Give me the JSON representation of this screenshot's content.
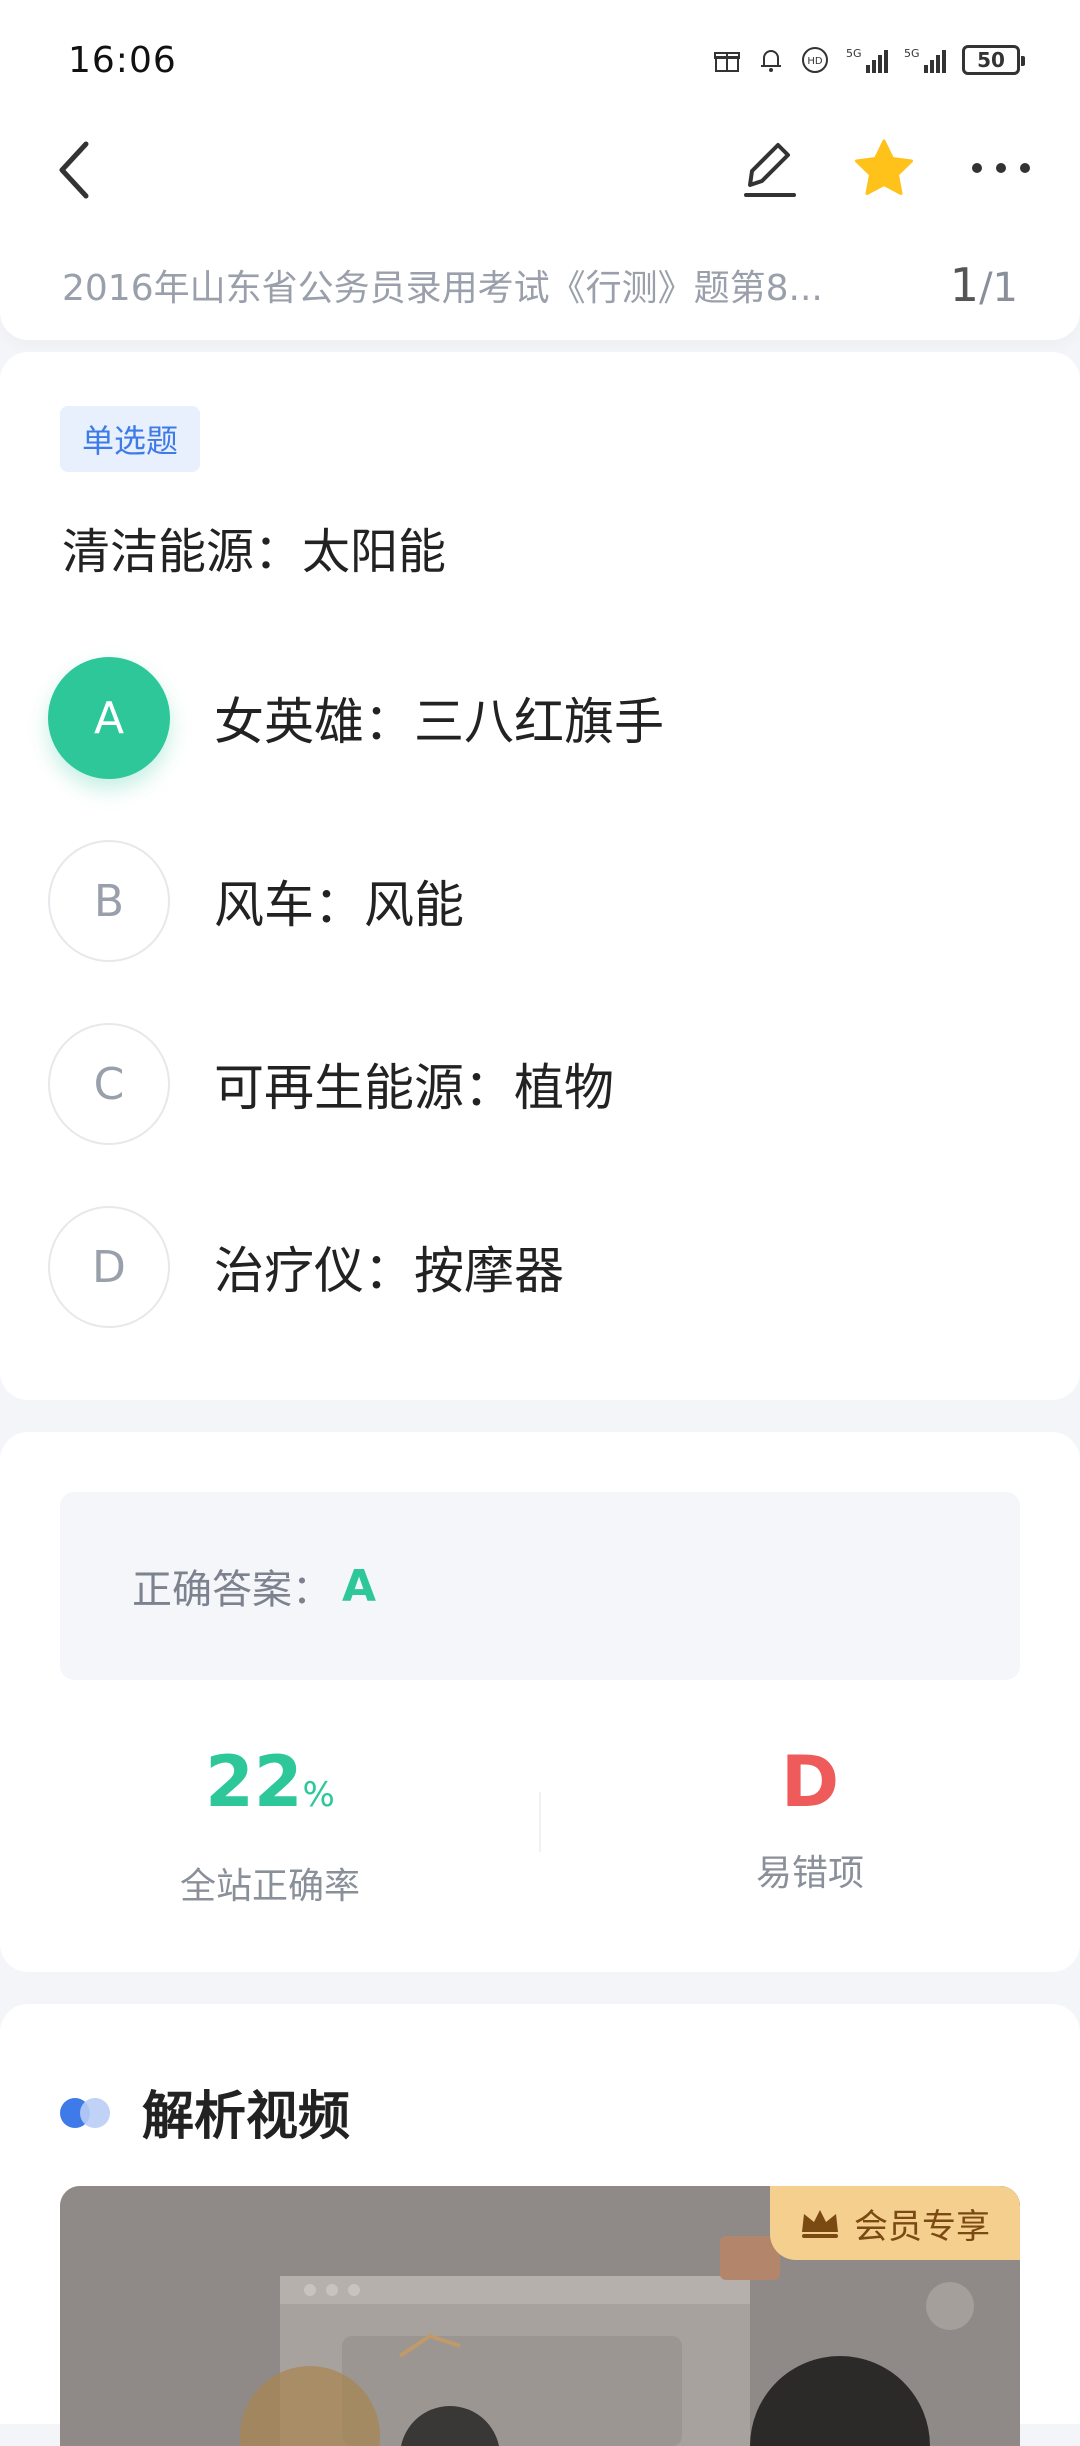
{
  "status_bar": {
    "time": "16:06",
    "icons": [
      "gift-icon",
      "bell-icon",
      "hd-icon",
      "5g-signal-icon",
      "5g-signal-icon"
    ],
    "battery": "50"
  },
  "nav": {
    "icons": [
      "back-icon",
      "edit-icon",
      "star-icon",
      "more-icon"
    ],
    "star_color": "#ffc21a"
  },
  "paper": {
    "title": "2016年山东省公务员录用考试《行测》题第8...",
    "current": "1",
    "total": "/1"
  },
  "question": {
    "type_tag": "单选题",
    "stem": "清洁能源：太阳能",
    "options": [
      {
        "letter": "A",
        "text": "女英雄：三八红旗手",
        "selected": true
      },
      {
        "letter": "B",
        "text": "风车：风能",
        "selected": false
      },
      {
        "letter": "C",
        "text": "可再生能源：植物",
        "selected": false
      },
      {
        "letter": "D",
        "text": "治疗仪：按摩器",
        "selected": false
      }
    ]
  },
  "answer": {
    "label": "正确答案：",
    "value": "A",
    "accuracy": {
      "value": "22",
      "unit": "%",
      "label": "全站正确率"
    },
    "common_wrong": {
      "value": "D",
      "label": "易错项"
    }
  },
  "video": {
    "title": "解析视频",
    "member_badge": "会员专享"
  },
  "colors": {
    "accent_green": "#2ec79a",
    "accent_blue": "#3f7be8",
    "error_red": "#ef5b5b",
    "badge_gold": "#f5cf8e"
  }
}
